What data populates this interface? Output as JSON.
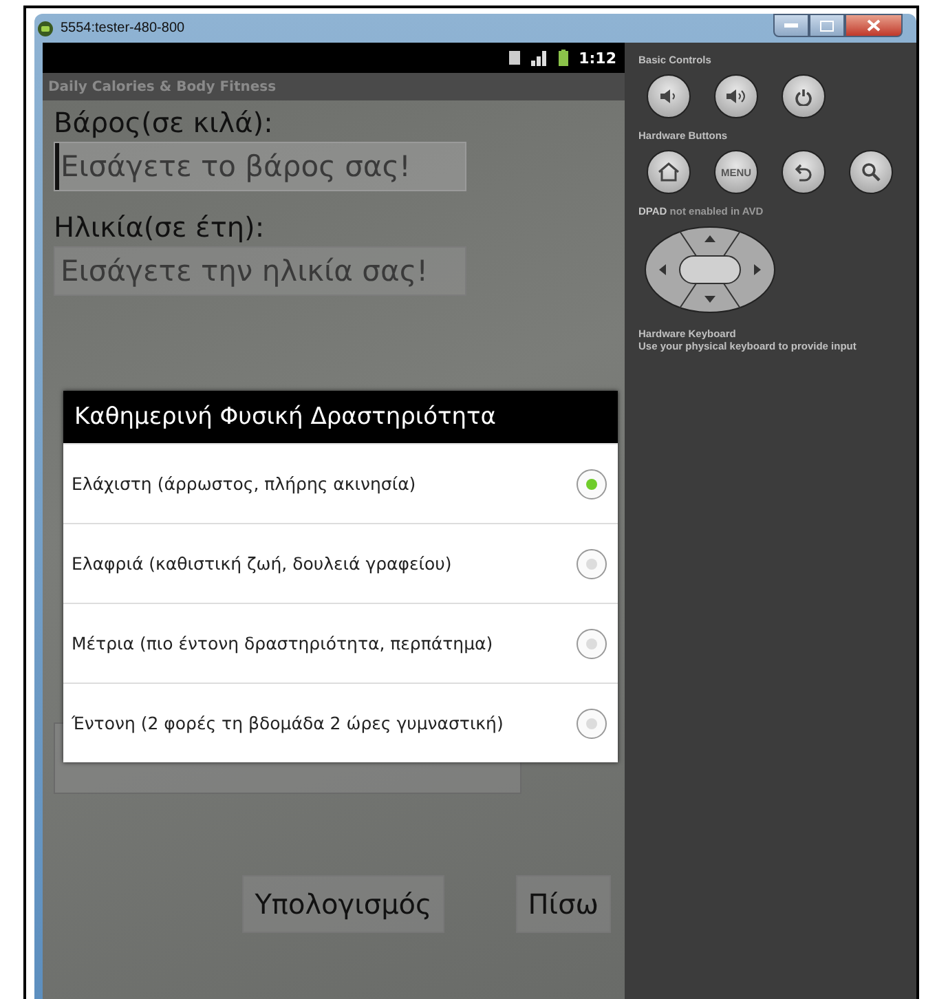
{
  "window": {
    "title": "5554:tester-480-800"
  },
  "status_bar": {
    "time": "1:12"
  },
  "app": {
    "title": "Daily Calories & Body Fitness",
    "fields": [
      {
        "label": "Βάρος(σε κιλά):",
        "placeholder": "Εισάγετε το βάρος σας!",
        "focused": true
      },
      {
        "label": "Ηλικία(σε έτη):",
        "placeholder": "Εισάγετε την ηλικία σας!",
        "focused": false
      }
    ],
    "buttons": [
      "Υπολογισμός",
      "Πίσω"
    ]
  },
  "dialog": {
    "title": "Καθημερινή Φυσική Δραστηριότητα",
    "options": [
      {
        "label": "Ελάχιστη (άρρωστος, πλήρης ακινησία)",
        "selected": true
      },
      {
        "label": "Ελαφριά (καθιστική ζωή, δουλειά γραφείου)",
        "selected": false
      },
      {
        "label": "Μέτρια (πιο έντονη δραστηριότητα, περπάτημα)",
        "selected": false
      },
      {
        "label": "Έντονη (2 φορές τη βδομάδα 2 ώρες γυμναστική)",
        "selected": false
      }
    ]
  },
  "controls_panel": {
    "basic_controls": {
      "title": "Basic Controls"
    },
    "hardware_buttons": {
      "title": "Hardware Buttons",
      "menu_label": "MENU"
    },
    "dpad": {
      "note": "**DPAD** not enabled in AVD"
    },
    "keyboard": {
      "title": "Hardware Keyboard",
      "hint": "Use your physical keyboard to provide input"
    }
  }
}
